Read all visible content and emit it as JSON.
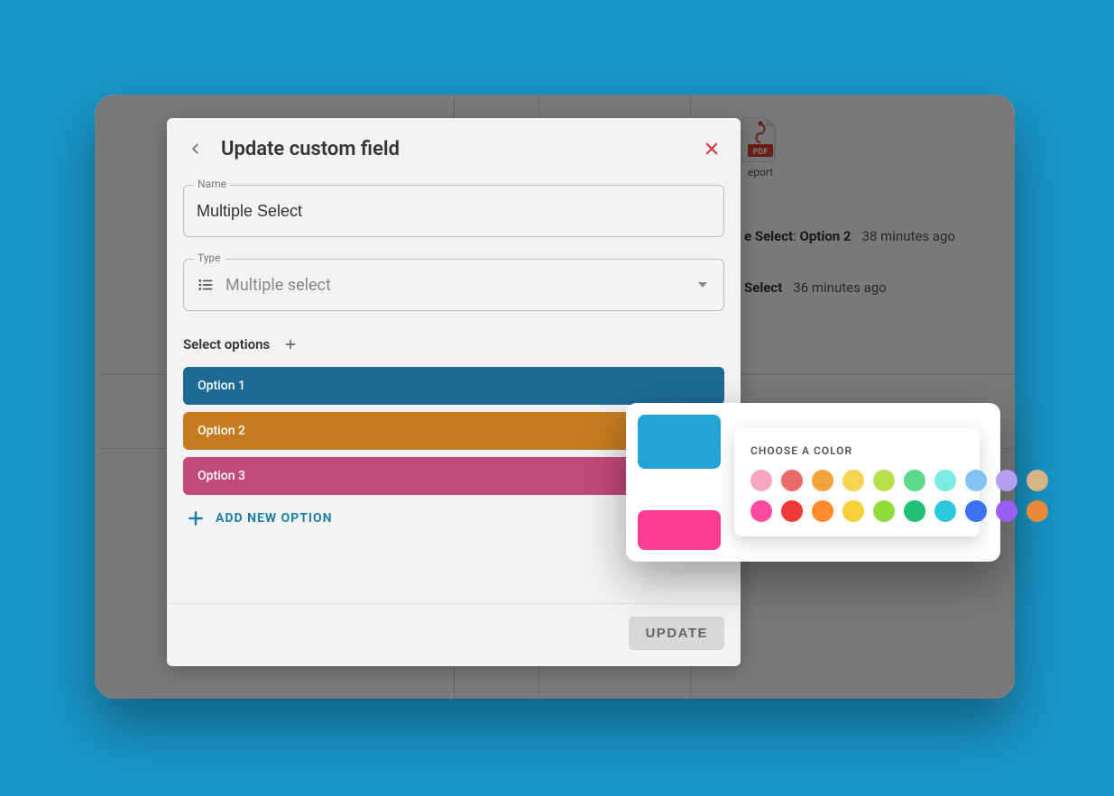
{
  "modal": {
    "title": "Update custom field",
    "name_label": "Name",
    "name_value": "Multiple Select",
    "type_label": "Type",
    "type_value": "Multiple select",
    "section": {
      "label": "Select options"
    },
    "options": [
      {
        "label": "Option 1",
        "color": "#1d6b94"
      },
      {
        "label": "Option 2",
        "color": "#c57c1f"
      },
      {
        "label": "Option 3",
        "color": "#c24a7c"
      }
    ],
    "add_option_label": "ADD NEW OPTION",
    "update_label": "UPDATE"
  },
  "popover": {
    "title": "CHOOSE A COLOR",
    "swatches": [
      "#f8a6c4",
      "#ea6a6a",
      "#f2a33c",
      "#f4d452",
      "#b9e04d",
      "#5bd88a",
      "#7aece3",
      "#7fc4f2",
      "#b79df2",
      "#d7b487",
      "#ff4aa1",
      "#f03a3a",
      "#ff8a2c",
      "#f6cf3a",
      "#8fdc3a",
      "#22c074",
      "#2cc6de",
      "#3a72f2",
      "#9a5ff2",
      "#e68a3a"
    ]
  },
  "background": {
    "pdf_filename_partial": "eport",
    "activity": [
      {
        "label_partial": "e Select",
        "value": "Option 2",
        "time": "38 minutes ago"
      },
      {
        "label_partial": "Select",
        "value": "",
        "time": "36 minutes ago"
      }
    ]
  }
}
